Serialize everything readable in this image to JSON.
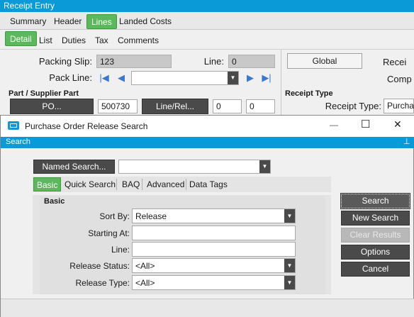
{
  "main_window": {
    "title": "Receipt Entry",
    "tabs": [
      "Summary",
      "Header",
      "Lines",
      "Landed Costs"
    ],
    "subtabs": [
      "Detail",
      "List",
      "Duties",
      "Tax",
      "Comments"
    ],
    "packing_slip_label": "Packing Slip:",
    "packing_slip_value": "123",
    "line_label": "Line:",
    "line_value": "0",
    "pack_line_label": "Pack Line:",
    "global_button": "Global",
    "receive_label": "Recei",
    "complete_label": "Comp",
    "part_supplier_label": "Part / Supplier Part",
    "po_button": "PO...",
    "po_value": "500730",
    "line_rel_button": "Line/Rel...",
    "line_val": "0",
    "rel_val": "0",
    "receipt_type_heading": "Receipt Type",
    "receipt_type_label": "Receipt Type:",
    "receipt_type_value": "Purcha"
  },
  "dialog": {
    "title": "Purchase Order Release Search",
    "search_bar": "Search",
    "named_search_button": "Named Search...",
    "named_search_value": "",
    "tabs": [
      "Basic",
      "Quick Search",
      "BAQ",
      "Advanced",
      "Data Tags"
    ],
    "group_title": "Basic",
    "fields": {
      "sort_by_label": "Sort By:",
      "sort_by_value": "Release",
      "starting_at_label": "Starting At:",
      "starting_at_value": "",
      "line_label": "Line:",
      "line_value": "",
      "release_status_label": "Release Status:",
      "release_status_value": "<All>",
      "release_type_label": "Release Type:",
      "release_type_value": "<All>"
    },
    "buttons": {
      "search": "Search",
      "new_search": "New Search",
      "clear_results": "Clear Results",
      "options": "Options",
      "cancel": "Cancel"
    },
    "window_controls": {
      "minimize": "—",
      "maximize": "☐",
      "close": "✕"
    },
    "pin_glyph": "⊥"
  }
}
